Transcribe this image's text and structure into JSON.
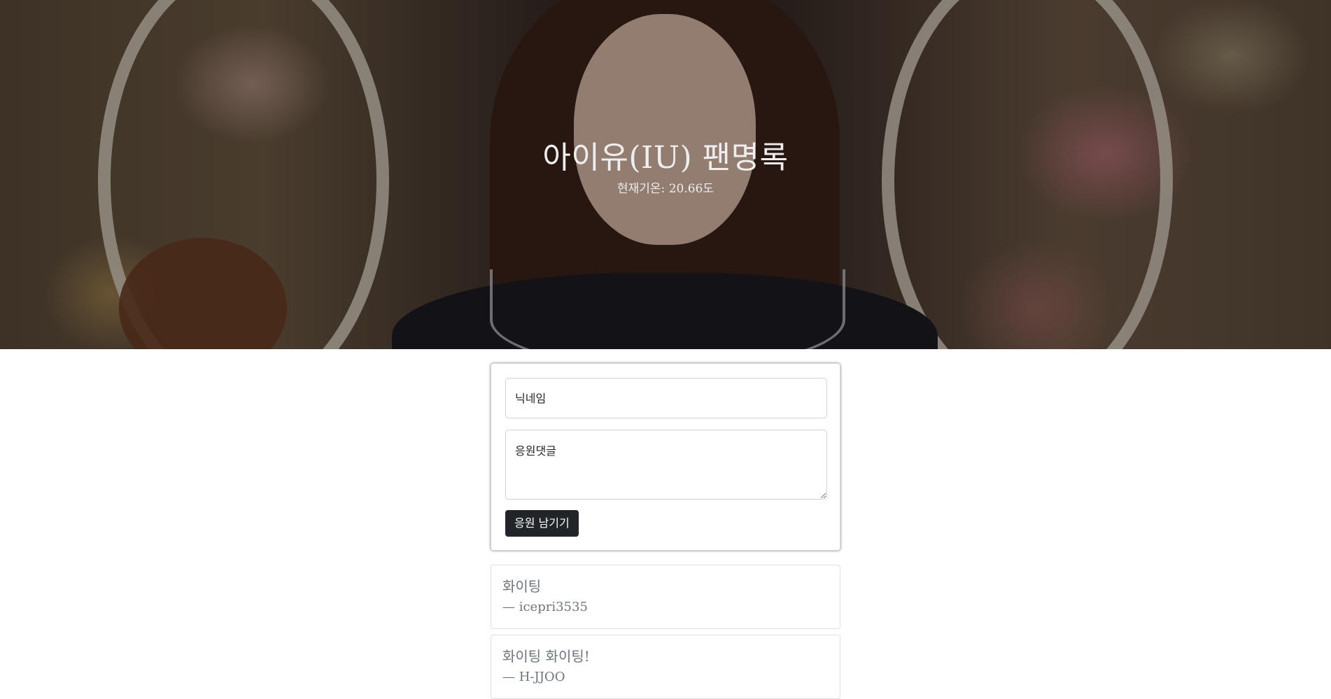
{
  "header": {
    "title": "아이유(IU) 팬명록",
    "temperature_text": "현재기온: 20.66도"
  },
  "form": {
    "nickname_placeholder": "닉네임",
    "comment_placeholder": "응원댓글",
    "submit_label": "응원 남기기"
  },
  "comments": [
    {
      "message": "화이팅",
      "author": "— icepri3535"
    },
    {
      "message": "화이팅 화이팅!",
      "author": "— H-JJOO"
    }
  ]
}
